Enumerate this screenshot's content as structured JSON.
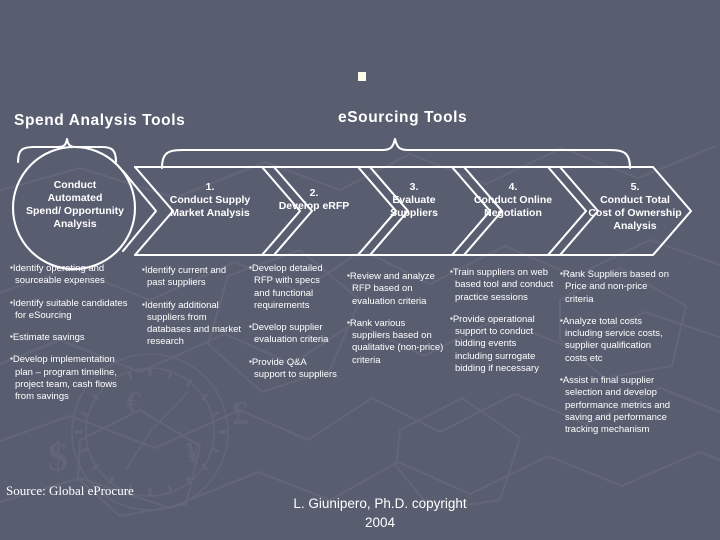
{
  "slide": {
    "background_color": "#595d70",
    "text_color": "#ffffff",
    "accent_square_color": "#fbfbe8",
    "top_marker_icon": "small-square-bullet"
  },
  "headings": {
    "spend_tools": "Spend Analysis Tools",
    "esourcing_tools": "eSourcing Tools"
  },
  "stages": [
    {
      "number": "",
      "title": "Conduct\nAutomated\nSpend/ Opportunity\nAnalysis",
      "lines": [
        "Conduct",
        "Automated",
        "Spend/ Opportunity",
        "Analysis"
      ],
      "shape": "circle"
    },
    {
      "number": "1.",
      "lines": [
        "Conduct Supply",
        "Market Analysis"
      ],
      "shape": "chevron"
    },
    {
      "number": "2.",
      "lines": [
        "Develop eRFP"
      ],
      "shape": "chevron"
    },
    {
      "number": "3.",
      "lines": [
        "Evaluate",
        "Suppliers"
      ],
      "shape": "chevron"
    },
    {
      "number": "4.",
      "lines": [
        "Conduct Online",
        "Negotiation"
      ],
      "shape": "chevron"
    },
    {
      "number": "5.",
      "lines": [
        "Conduct Total",
        "Cost of Ownership",
        "Analysis"
      ],
      "shape": "chevron"
    }
  ],
  "columns": [
    {
      "bullets": [
        "Identify operating and sourceable expenses",
        "Identify suitable candidates for eSourcing",
        "Estimate savings",
        "Develop implementation plan – program timeline, project team, cash flows from savings"
      ]
    },
    {
      "bullets": [
        "Identify current and past suppliers",
        "Identify additional suppliers from databases and market research"
      ]
    },
    {
      "bullets": [
        "Develop detailed RFP with specs and functional requirements",
        "Develop supplier evaluation criteria",
        "Provide Q&A support to suppliers"
      ]
    },
    {
      "bullets": [
        "Review and analyze RFP based on evaluation criteria",
        "Rank various suppliers based on qualitative (non-price) criteria"
      ]
    },
    {
      "bullets": [
        "Train suppliers on web based tool and conduct practice sessions",
        "Provide operational support to conduct bidding events including surrogate bidding if necessary"
      ]
    },
    {
      "bullets": [
        "Rank Suppliers based on Price and non-price criteria",
        "Analyze total costs including service costs, supplier qualification costs etc",
        "Assist in final supplier selection and develop performance metrics and saving and performance tracking mechanism"
      ]
    }
  ],
  "footer": {
    "source": "Source: Global eProcure",
    "copyright_line1": "L. Giunipero, Ph.D. copyright",
    "copyright_line2": "2004"
  }
}
